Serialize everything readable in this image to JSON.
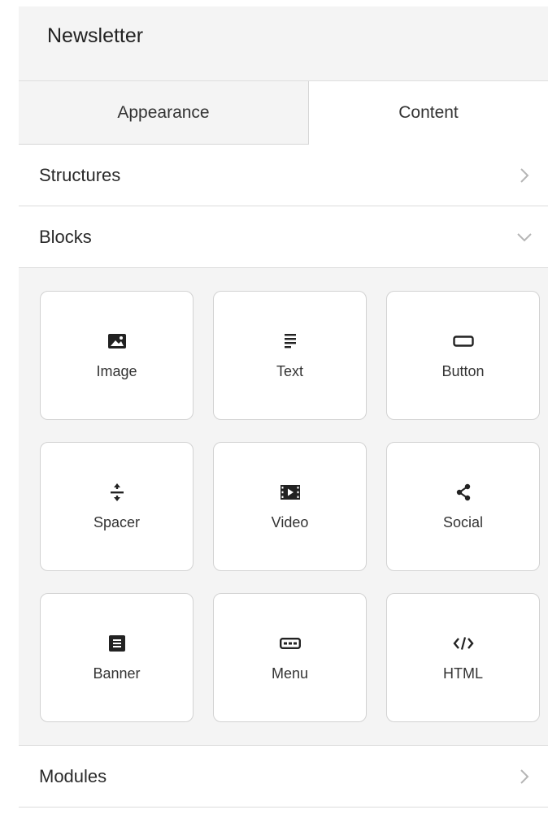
{
  "header": {
    "title": "Newsletter"
  },
  "tabs": [
    {
      "label": "Appearance",
      "active": false
    },
    {
      "label": "Content",
      "active": true
    }
  ],
  "sections": {
    "structures": {
      "label": "Structures",
      "state": "collapsed",
      "icon": "chevron-right-icon"
    },
    "blocks": {
      "label": "Blocks",
      "state": "expanded",
      "icon": "chevron-down-icon"
    },
    "modules": {
      "label": "Modules",
      "state": "collapsed",
      "icon": "chevron-right-icon"
    }
  },
  "blocks": [
    {
      "label": "Image",
      "icon": "image-icon"
    },
    {
      "label": "Text",
      "icon": "text-icon"
    },
    {
      "label": "Button",
      "icon": "button-icon"
    },
    {
      "label": "Spacer",
      "icon": "spacer-icon"
    },
    {
      "label": "Video",
      "icon": "video-icon"
    },
    {
      "label": "Social",
      "icon": "share-icon"
    },
    {
      "label": "Banner",
      "icon": "banner-icon"
    },
    {
      "label": "Menu",
      "icon": "menu-icon"
    },
    {
      "label": "HTML",
      "icon": "code-icon"
    }
  ],
  "colors": {
    "panel_bg": "#f4f4f4",
    "card_bg": "#ffffff",
    "border": "#d2d2d2",
    "text": "#222222",
    "chevron": "#b5b5b5"
  }
}
